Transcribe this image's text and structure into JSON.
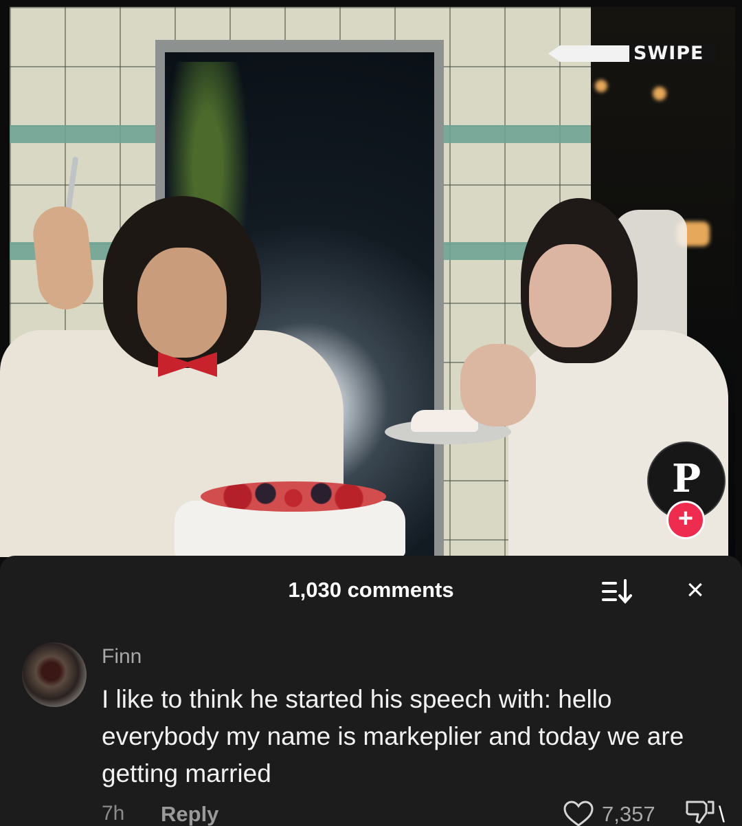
{
  "overlay": {
    "swipe_label": "SWIPE",
    "logo_glyph": "P",
    "add_glyph": "+"
  },
  "comments_panel": {
    "count_label": "1,030 comments",
    "sort_icon": "sort-icon",
    "close_glyph": "×"
  },
  "comment": {
    "author": "Finn",
    "text": "I like to think he started his speech with: hello everybody my name is markeplier and today we are getting married",
    "time": "7h",
    "reply_label": "Reply",
    "like_count": "7,357",
    "trailing_glyph": "\\"
  },
  "colors": {
    "sheet_bg": "#1c1c1c",
    "accent_plus": "#ee2c4f"
  }
}
